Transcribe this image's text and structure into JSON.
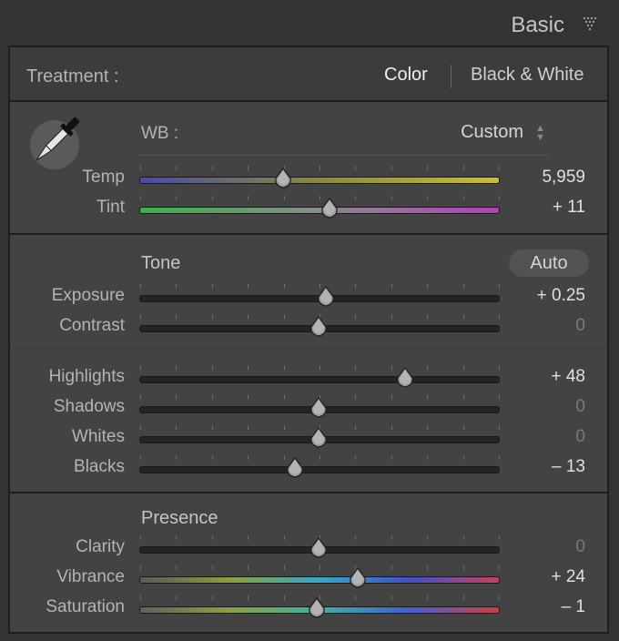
{
  "header": {
    "title": "Basic",
    "collapse_icon": "triangle-down-icon"
  },
  "treatment": {
    "label": "Treatment :",
    "color_label": "Color",
    "bw_label": "Black & White"
  },
  "wb": {
    "label": "WB :",
    "value": "Custom",
    "eyedropper_icon": "eyedropper-icon"
  },
  "sliders": {
    "temp": {
      "label": "Temp",
      "value": "5,959",
      "fraction": 0.4
    },
    "tint": {
      "label": "Tint",
      "value": "+ 11",
      "fraction": 0.53
    },
    "exposure": {
      "label": "Exposure",
      "value": "+ 0.25",
      "fraction": 0.52
    },
    "contrast": {
      "label": "Contrast",
      "value": "0",
      "fraction": 0.5
    },
    "highlights": {
      "label": "Highlights",
      "value": "+ 48",
      "fraction": 0.74
    },
    "shadows": {
      "label": "Shadows",
      "value": "0",
      "fraction": 0.5
    },
    "whites": {
      "label": "Whites",
      "value": "0",
      "fraction": 0.5
    },
    "blacks": {
      "label": "Blacks",
      "value": "– 13",
      "fraction": 0.435
    },
    "clarity": {
      "label": "Clarity",
      "value": "0",
      "fraction": 0.5
    },
    "vibrance": {
      "label": "Vibrance",
      "value": "+ 24",
      "fraction": 0.61
    },
    "saturation": {
      "label": "Saturation",
      "value": "– 1",
      "fraction": 0.495
    }
  },
  "tone": {
    "heading": "Tone",
    "auto_label": "Auto"
  },
  "presence": {
    "heading": "Presence"
  },
  "colors": {
    "temp_gradient": [
      "#4a4aa8",
      "#8a8a3a",
      "#c8c030"
    ],
    "tint_gradient": [
      "#38b048",
      "#8a8a8a",
      "#b040b8"
    ],
    "vibrance_gradient": [
      "#5a5a5a",
      "#8aa03a",
      "#38a8c8",
      "#4050c8",
      "#c84060"
    ],
    "saturation_gradient": [
      "#606060",
      "#8aa040",
      "#40b0a0",
      "#4060d0",
      "#d04040"
    ]
  }
}
